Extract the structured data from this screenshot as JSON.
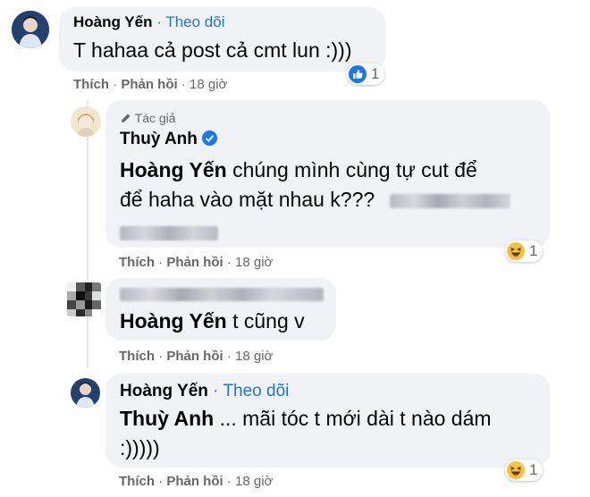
{
  "comments": [
    {
      "author": "Hoàng Yến",
      "follow": "Theo dõi",
      "text": "T hahaa cả post cả cmt lun :)))",
      "reaction": {
        "type": "like-icon",
        "count": "1"
      },
      "actions": {
        "like": "Thích",
        "reply": "Phản hồi",
        "time": "18 giờ"
      }
    },
    {
      "badge": "Tác giả",
      "author": "Thuỳ Anh",
      "mention": "Hoàng Yến",
      "text_line1": "chúng mình cùng tự cut để",
      "text_line2": "để haha vào mặt nhau k???",
      "reaction": {
        "type": "haha-icon",
        "count": "1"
      },
      "actions": {
        "like": "Thích",
        "reply": "Phản hồi",
        "time": "18 giờ"
      }
    },
    {
      "mention": "Hoàng Yến",
      "text": "t cũng v",
      "actions": {
        "like": "Thích",
        "reply": "Phản hồi",
        "time": "18 giờ"
      }
    },
    {
      "author": "Hoàng Yến",
      "follow": "Theo dõi",
      "mention": "Thuỳ Anh",
      "text_line1": "... mãi tóc t mới dài t nào dám",
      "text_line2": ":)))))",
      "reaction": {
        "type": "haha-icon",
        "count": "1"
      },
      "actions": {
        "like": "Thích",
        "reply": "Phản hồi",
        "time": "18 giờ"
      }
    }
  ],
  "colors": {
    "link": "#1b74e4",
    "bubble": "#f0f2f5",
    "meta": "#65676b",
    "verified": "#1877f2"
  }
}
